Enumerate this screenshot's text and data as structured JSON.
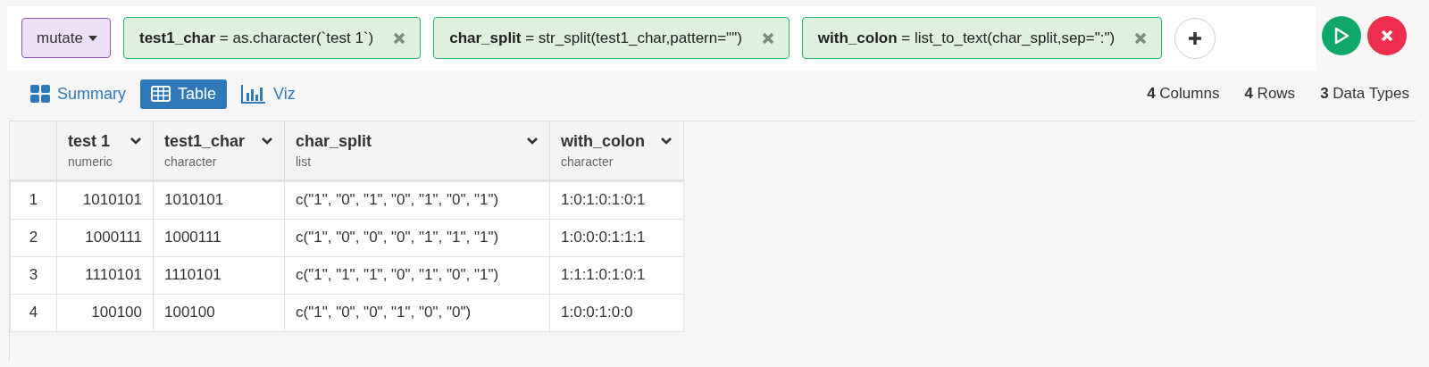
{
  "command_bar": {
    "verb": "mutate",
    "steps": [
      {
        "text": "**test1_char** = as.character(`test 1`)"
      },
      {
        "text": "**char_split** = str_split(test1_char,pattern=\"\")"
      },
      {
        "text": "**with_colon** = list_to_text(char_split,sep=\":\")"
      }
    ]
  },
  "view_tabs": [
    {
      "label": "Summary",
      "kind": "grid",
      "selected": false
    },
    {
      "label": "Table",
      "kind": "table",
      "selected": true
    },
    {
      "label": "Viz",
      "kind": "chart",
      "selected": false
    }
  ],
  "stats": [
    "**4** Columns",
    "**4** Rows",
    "**3** Data Types"
  ],
  "table": {
    "columns": [
      {
        "name": "test 1",
        "type": "numeric"
      },
      {
        "name": "test1_char",
        "type": "character"
      },
      {
        "name": "char_split",
        "type": "list"
      },
      {
        "name": "with_colon",
        "type": "character"
      }
    ],
    "rows": [
      {
        "index": "1",
        "cells": [
          "1010101",
          "1010101",
          "c(\"1\", \"0\", \"1\", \"0\", \"1\", \"0\", \"1\")",
          "1:0:1:0:1:0:1"
        ]
      },
      {
        "index": "2",
        "cells": [
          "1000111",
          "1000111",
          "c(\"1\", \"0\", \"0\", \"0\", \"1\", \"1\", \"1\")",
          "1:0:0:0:1:1:1"
        ]
      },
      {
        "index": "3",
        "cells": [
          "1110101",
          "1110101",
          "c(\"1\", \"1\", \"1\", \"0\", \"1\", \"0\", \"1\")",
          "1:1:1:0:1:0:1"
        ]
      },
      {
        "index": "4",
        "cells": [
          "100100",
          "100100",
          "c(\"1\", \"0\", \"0\", \"1\", \"0\", \"0\")",
          "1:0:0:1:0:0"
        ]
      }
    ]
  }
}
